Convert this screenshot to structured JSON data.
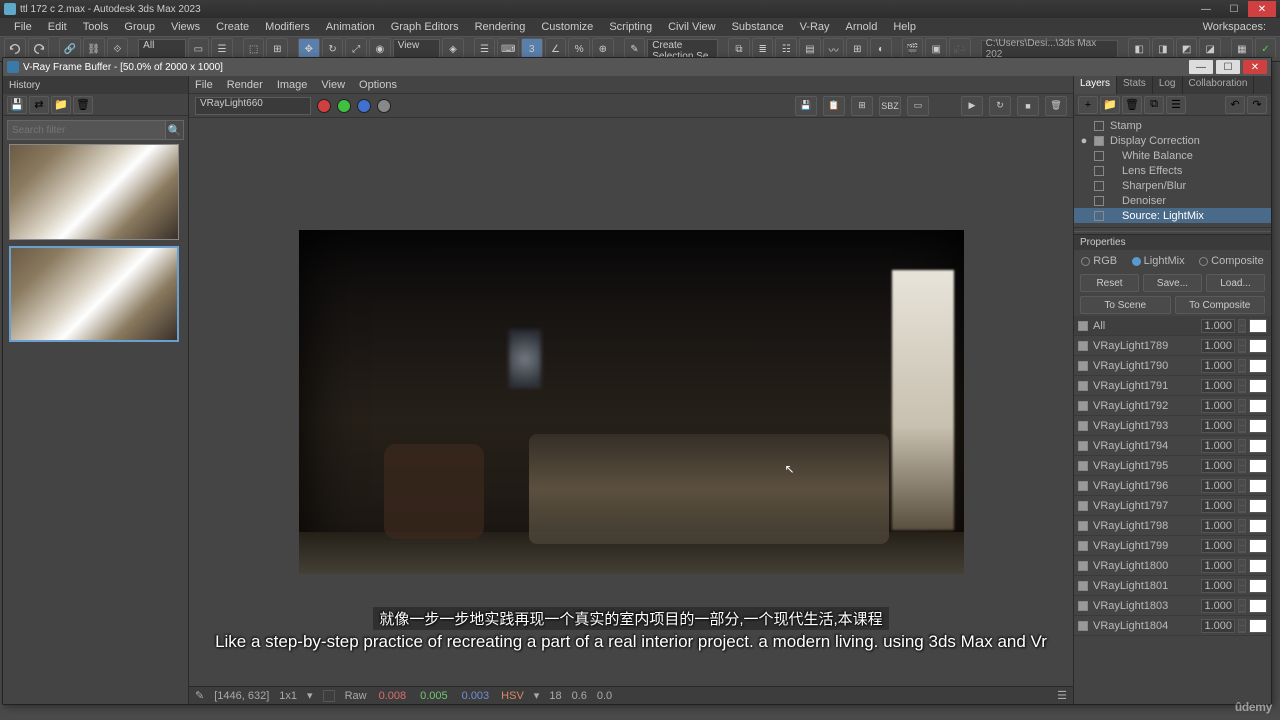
{
  "app": {
    "title": "ttl 172 c 2.max - Autodesk 3ds Max 2023",
    "menus": [
      "File",
      "Edit",
      "Tools",
      "Group",
      "Views",
      "Create",
      "Modifiers",
      "Animation",
      "Graph Editors",
      "Rendering",
      "Customize",
      "Scripting",
      "Civil View",
      "Substance",
      "V-Ray",
      "Arnold",
      "Help"
    ],
    "workspaces_label": "Workspaces:",
    "toolbar_view": "View",
    "toolbar_all": "All",
    "toolbar_selset": "Create Selection Se",
    "path_combo": "C:\\Users\\Desi...\\3ds Max 202"
  },
  "vfb": {
    "title": "V-Ray Frame Buffer - [50.0% of 2000 x 1000]",
    "history_label": "History",
    "search_placeholder": "Search filter",
    "viewer_menus": [
      "File",
      "Render",
      "Image",
      "View",
      "Options"
    ],
    "element_select": "VRayLight660",
    "sbz_label": "SBZ"
  },
  "right": {
    "tabs": [
      "Layers",
      "Stats",
      "Log",
      "Collaboration"
    ],
    "layers": [
      {
        "name": "Stamp",
        "checked": false,
        "sel": false,
        "eye": ""
      },
      {
        "name": "Display Correction",
        "checked": true,
        "sel": false,
        "eye": "●"
      },
      {
        "name": "White Balance",
        "checked": false,
        "sel": false,
        "indent": true
      },
      {
        "name": "Lens Effects",
        "checked": false,
        "sel": false,
        "indent": true
      },
      {
        "name": "Sharpen/Blur",
        "checked": false,
        "sel": false,
        "indent": true
      },
      {
        "name": "Denoiser",
        "checked": false,
        "sel": false,
        "indent": true
      },
      {
        "name": "Source: LightMix",
        "checked": false,
        "sel": true,
        "indent": true
      }
    ],
    "props_label": "Properties",
    "modes": [
      "RGB",
      "LightMix",
      "Composite"
    ],
    "mode_on": "LightMix",
    "btns1": [
      "Reset",
      "Save...",
      "Load..."
    ],
    "btns2": [
      "To Scene",
      "To Composite"
    ],
    "all_label": "All",
    "all_value": "1.000",
    "lights": [
      {
        "name": "VRayLight1789",
        "val": "1.000"
      },
      {
        "name": "VRayLight1790",
        "val": "1.000"
      },
      {
        "name": "VRayLight1791",
        "val": "1.000"
      },
      {
        "name": "VRayLight1792",
        "val": "1.000"
      },
      {
        "name": "VRayLight1793",
        "val": "1.000"
      },
      {
        "name": "VRayLight1794",
        "val": "1.000"
      },
      {
        "name": "VRayLight1795",
        "val": "1.000"
      },
      {
        "name": "VRayLight1796",
        "val": "1.000"
      },
      {
        "name": "VRayLight1797",
        "val": "1.000"
      },
      {
        "name": "VRayLight1798",
        "val": "1.000"
      },
      {
        "name": "VRayLight1799",
        "val": "1.000"
      },
      {
        "name": "VRayLight1800",
        "val": "1.000"
      },
      {
        "name": "VRayLight1801",
        "val": "1.000"
      },
      {
        "name": "VRayLight1803",
        "val": "1.000"
      },
      {
        "name": "VRayLight1804",
        "val": "1.000"
      }
    ]
  },
  "status": {
    "coords": "[1446, 632]",
    "zoom": "1x1",
    "raw": "Raw",
    "r": "0.008",
    "g": "0.005",
    "b": "0.003",
    "hsv_label": "HSV",
    "h": "18",
    "s": "0.6",
    "v": "0.0"
  },
  "subtitle": {
    "cn": "就像一步一步地实践再现一个真实的室内项目的一部分,一个现代生活,本课程",
    "en": "Like a step-by-step practice of recreating a part of a real interior project. a modern living. using 3ds Max and Vr"
  },
  "udemy": "ûdemy"
}
